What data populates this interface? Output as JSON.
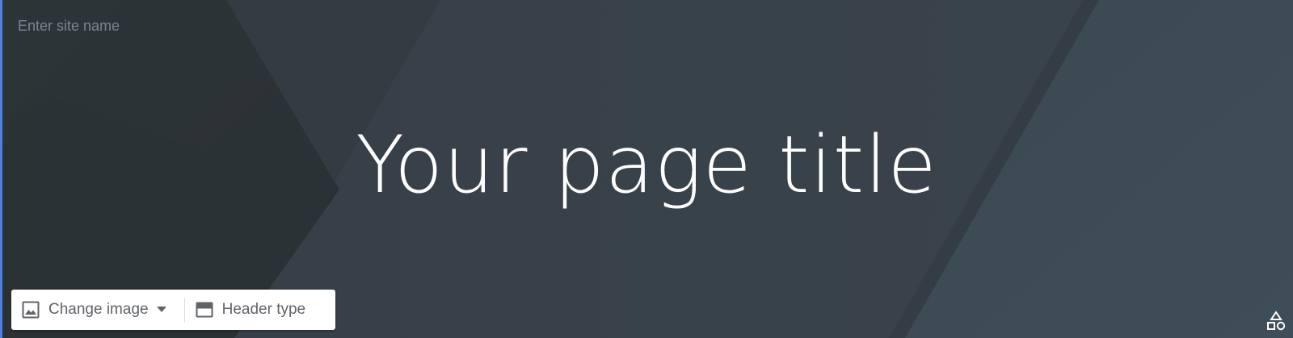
{
  "site": {
    "name_placeholder": "Enter site name",
    "name_value": ""
  },
  "header": {
    "title": "Your page title"
  },
  "toolbar": {
    "change_image_label": "Change image",
    "header_type_label": "Header type"
  },
  "icons": {
    "change_image": "image-icon",
    "dropdown": "caret-down-icon",
    "header_type": "header-layout-icon",
    "shapes": "shapes-icon"
  },
  "colors": {
    "background": "#37424a",
    "title": "#ffffff",
    "accent": "#4a82e4",
    "toolbar_bg": "#ffffff",
    "toolbar_text": "#5f6368"
  }
}
